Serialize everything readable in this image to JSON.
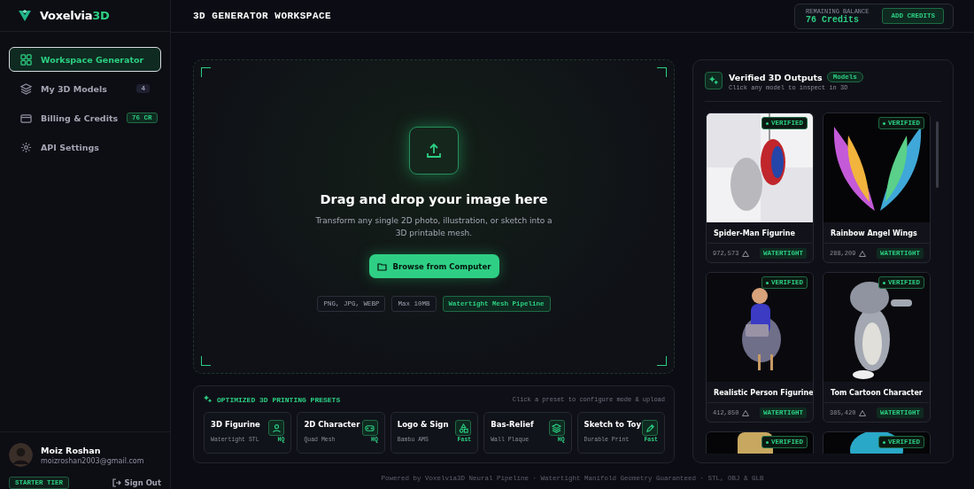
{
  "brand": {
    "name": "Voxelvia",
    "suffix": "3D"
  },
  "nav": [
    {
      "label": "Workspace Generator",
      "selected": true
    },
    {
      "label": "My 3D Models",
      "selected": false,
      "badge": "4",
      "kind": "neutral"
    },
    {
      "label": "Billing & Credits",
      "selected": false,
      "badge": "76 CR",
      "kind": "accent"
    },
    {
      "label": "API Settings",
      "selected": false
    }
  ],
  "user": {
    "name": "Moiz Roshan",
    "email": "moizroshan2003@gmail.com",
    "tier": "STARTER TIER",
    "sign_out": "Sign Out"
  },
  "header": {
    "title": "3D GENERATOR WORKSPACE",
    "balance_label": "REMAINING BALANCE",
    "balance": "76 Credits",
    "add_button": "ADD CREDITS"
  },
  "upload": {
    "title": "Drag and drop your image here",
    "description": "Transform any single 2D photo, illustration, or sketch into a 3D printable mesh.",
    "button": "Browse from Computer",
    "tags": [
      {
        "label": "PNG, JPG, WEBP",
        "kind": "plain"
      },
      {
        "label": "Max 10MB",
        "kind": "plain"
      },
      {
        "label": "Watertight Mesh Pipeline",
        "kind": "accent"
      }
    ]
  },
  "presets": {
    "title": "OPTIMIZED 3D PRINTING PRESETS",
    "hint": "Click a preset to configure mode & upload",
    "items": [
      {
        "name": "3D Figurine",
        "detail": "Watertight STL",
        "speed": "HQ"
      },
      {
        "name": "2D Character",
        "detail": "Quad Mesh",
        "speed": "HQ"
      },
      {
        "name": "Logo & Sign",
        "detail": "Bambu AMS",
        "speed": "Fast"
      },
      {
        "name": "Bas-Relief",
        "detail": "Wall Plaque",
        "speed": "HQ"
      },
      {
        "name": "Sketch to Toy",
        "detail": "Durable Print",
        "speed": "Fast"
      }
    ]
  },
  "gallery": {
    "title": "Verified 3D Outputs",
    "tag": "Models",
    "subtitle": "Click any model to inspect in 3D",
    "items": [
      {
        "badge": "VERIFIED",
        "title": "Spider-Man Figurine",
        "polys": "972,573",
        "mesh": "WATERTIGHT"
      },
      {
        "badge": "VERIFIED",
        "title": "Rainbow Angel Wings",
        "polys": "288,209",
        "mesh": "WATERTIGHT"
      },
      {
        "badge": "VERIFIED",
        "title": "Realistic Person Figurine",
        "polys": "412,850",
        "mesh": "WATERTIGHT"
      },
      {
        "badge": "VERIFIED",
        "title": "Tom Cartoon Character",
        "polys": "385,420",
        "mesh": "WATERTIGHT"
      },
      {
        "badge": "VERIFIED"
      },
      {
        "badge": "VERIFIED"
      }
    ]
  },
  "footer": "Powered by Voxelvia3D Neural Pipeline · Watertight Manifold Geometry Guaranteed · STL, OBJ & GLB"
}
